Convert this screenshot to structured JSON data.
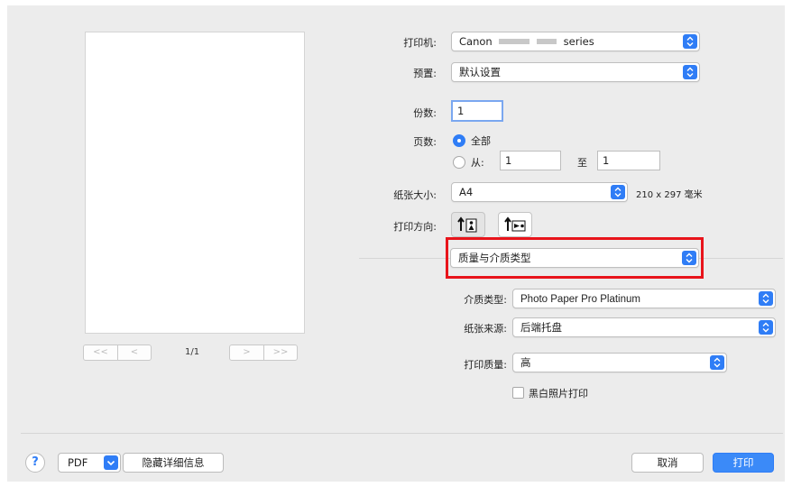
{
  "accent_color": "#2f7df6",
  "highlight_color": "#e8141b",
  "preview": {
    "pager_first_label": "<<",
    "pager_prev_label": "<",
    "pager_next_label": ">",
    "pager_last_label": ">>",
    "page_counter": "1/1"
  },
  "printer": {
    "label": "打印机:",
    "value_prefix": "Canon",
    "value_suffix": "series"
  },
  "presets": {
    "label": "预置:",
    "value": "默认设置"
  },
  "copies": {
    "label": "份数:",
    "value": "1"
  },
  "pages": {
    "label": "页数:",
    "all_label": "全部",
    "from_label": "从:",
    "from_value": "1",
    "to_label": "至",
    "to_value": "1",
    "selected": "all"
  },
  "paper_size": {
    "label": "纸张大小:",
    "value": "A4",
    "dimensions": "210 x 297 毫米"
  },
  "orientation": {
    "label": "打印方向:",
    "selected": "portrait"
  },
  "section_popup": {
    "value": "质量与介质类型"
  },
  "media_type": {
    "label": "介质类型:",
    "value": "Photo Paper Pro Platinum"
  },
  "paper_source": {
    "label": "纸张来源:",
    "value": "后端托盘"
  },
  "print_quality": {
    "label": "打印质量:",
    "value": "高"
  },
  "grayscale": {
    "label": "黑白照片打印",
    "checked": false
  },
  "footer": {
    "help_label": "?",
    "pdf_label": "PDF",
    "hide_details_label": "隐藏详细信息",
    "cancel_label": "取消",
    "print_label": "打印"
  }
}
